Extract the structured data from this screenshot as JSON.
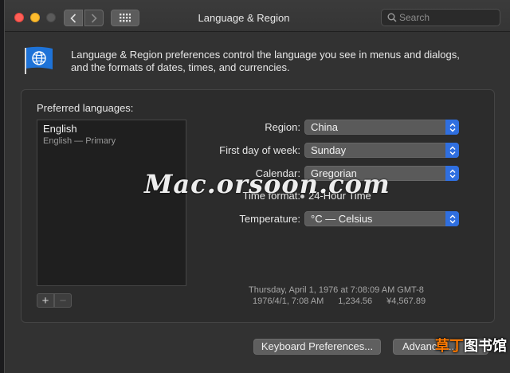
{
  "window": {
    "title": "Language & Region",
    "traffic_lights": [
      "close",
      "minimize",
      "zoom"
    ],
    "nav": {
      "back_icon": "chevron-left-icon",
      "forward_icon": "chevron-right-icon",
      "grid_icon": "grid-icon"
    }
  },
  "search": {
    "placeholder": "Search",
    "icon": "search-icon"
  },
  "header": {
    "icon": "globe-flag-icon",
    "description": "Language & Region preferences control the language you see in menus and dialogs, and the formats of dates, times, and currencies."
  },
  "languages": {
    "label": "Preferred languages:",
    "items": [
      {
        "name": "English",
        "detail": "English — Primary"
      }
    ],
    "add_label": "+",
    "remove_label": "−"
  },
  "settings": {
    "region": {
      "label": "Region:",
      "value": "China"
    },
    "first_day": {
      "label": "First day of week:",
      "value": "Sunday"
    },
    "calendar": {
      "label": "Calendar:",
      "value": "Gregorian"
    },
    "time_format": {
      "label": "Time format:",
      "value": "24-Hour Time",
      "checked": true
    },
    "temperature": {
      "label": "Temperature:",
      "value": "°C — Celsius"
    }
  },
  "sample": {
    "line1": "Thursday, April 1, 1976 at 7:08:09 AM GMT-8",
    "date_short": "1976/4/1, 7:08 AM",
    "number": "1,234.56",
    "currency": "¥4,567.89"
  },
  "buttons": {
    "keyboard": "Keyboard Preferences...",
    "advanced": "Advanced..."
  },
  "watermark": "Mac.orsoon.com",
  "logo_badge": {
    "highlight": "草丁",
    "rest": "图书馆"
  },
  "colors": {
    "accent": "#2f6fe0",
    "close": "#ff5f57",
    "minimize": "#febc2e"
  }
}
